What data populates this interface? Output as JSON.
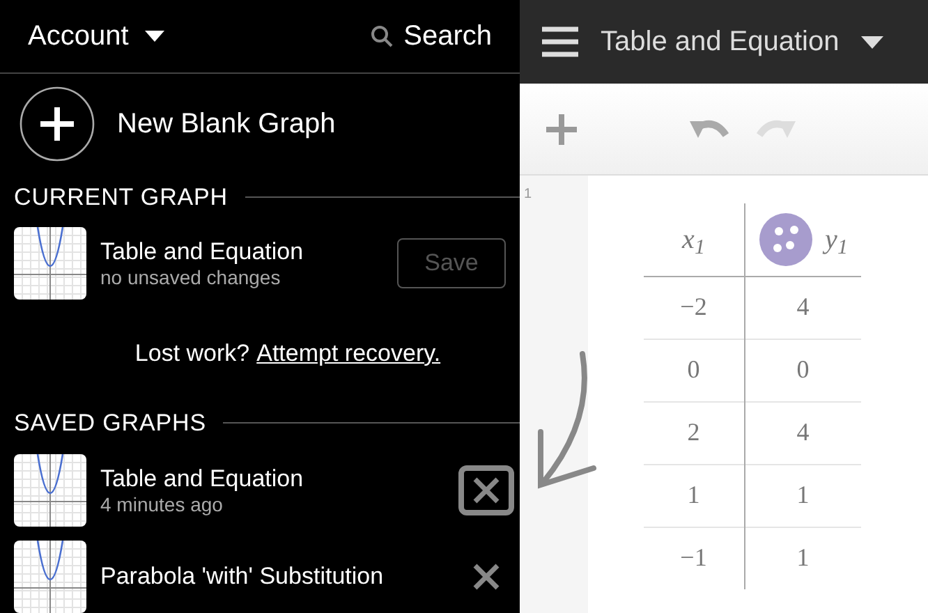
{
  "sidebar": {
    "account": "Account",
    "search": "Search",
    "new_graph": "New Blank Graph",
    "current": {
      "heading": "CURRENT GRAPH",
      "title": "Table and Equation",
      "subtitle": "no unsaved changes",
      "save": {
        "label": "Save",
        "disabled": true
      }
    },
    "lost_work": {
      "text": "Lost work?",
      "link": "Attempt recovery."
    },
    "saved": {
      "heading": "SAVED GRAPHS",
      "items": [
        {
          "title": "Table and Equation",
          "subtitle": "4 minutes ago",
          "highlighted": true
        },
        {
          "title": "Parabola 'with' Substitution",
          "highlighted": false
        }
      ]
    }
  },
  "header": {
    "title": "Table and Equation"
  },
  "expression_list": {
    "line_number": "1",
    "table": {
      "columns": [
        "x$_{1}$",
        "y$_{1}$"
      ],
      "rows": [
        [
          "−2",
          "4"
        ],
        [
          "0",
          "0"
        ],
        [
          "2",
          "4"
        ],
        [
          "1",
          "1"
        ],
        [
          "−1",
          "1"
        ]
      ]
    }
  }
}
